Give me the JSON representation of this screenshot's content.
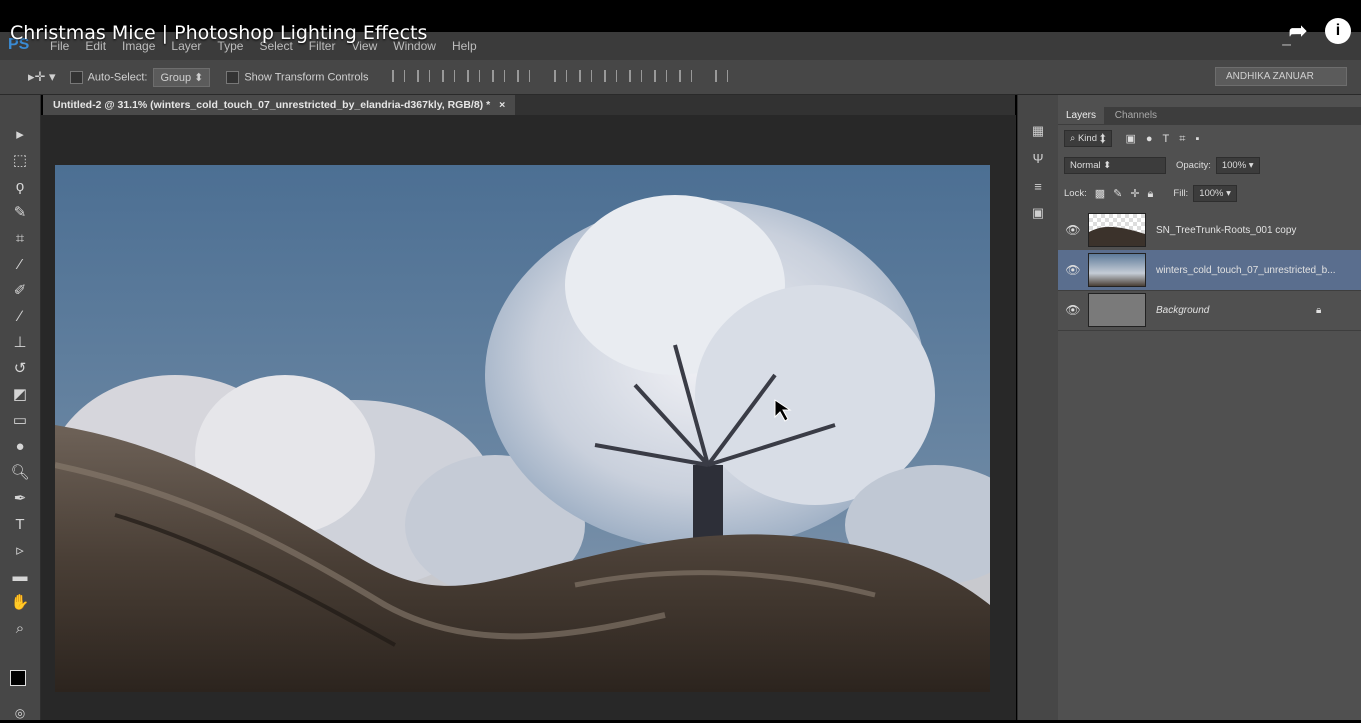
{
  "video": {
    "title": "Christmas Mice | Photoshop Lighting Effects"
  },
  "menu": {
    "logo": "PS",
    "items": [
      "File",
      "Edit",
      "Image",
      "Layer",
      "Type",
      "Select",
      "Filter",
      "View",
      "Window",
      "Help"
    ]
  },
  "options": {
    "auto_select_label": "Auto-Select:",
    "auto_select_value": "Group",
    "show_transform_label": "Show Transform Controls",
    "user": "ANDHIKA ZANUAR"
  },
  "document": {
    "tab_title": "Untitled-2 @ 31.1% (winters_cold_touch_07_unrestricted_by_elandria-d367kly, RGB/8) *",
    "close": "×"
  },
  "panel": {
    "tabs": [
      "Layers",
      "Channels"
    ],
    "filter_kind": "Kind",
    "blend_mode": "Normal",
    "opacity_label": "Opacity:",
    "opacity_value": "100%",
    "lock_label": "Lock:",
    "fill_label": "Fill:",
    "fill_value": "100%",
    "layers": [
      {
        "name": "SN_TreeTrunk-Roots_001 copy"
      },
      {
        "name": "winters_cold_touch_07_unrestricted_b..."
      },
      {
        "name": "Background"
      }
    ]
  },
  "colors": {
    "accent": "#3a8bd4",
    "selected_layer": "#5a6e8e"
  }
}
